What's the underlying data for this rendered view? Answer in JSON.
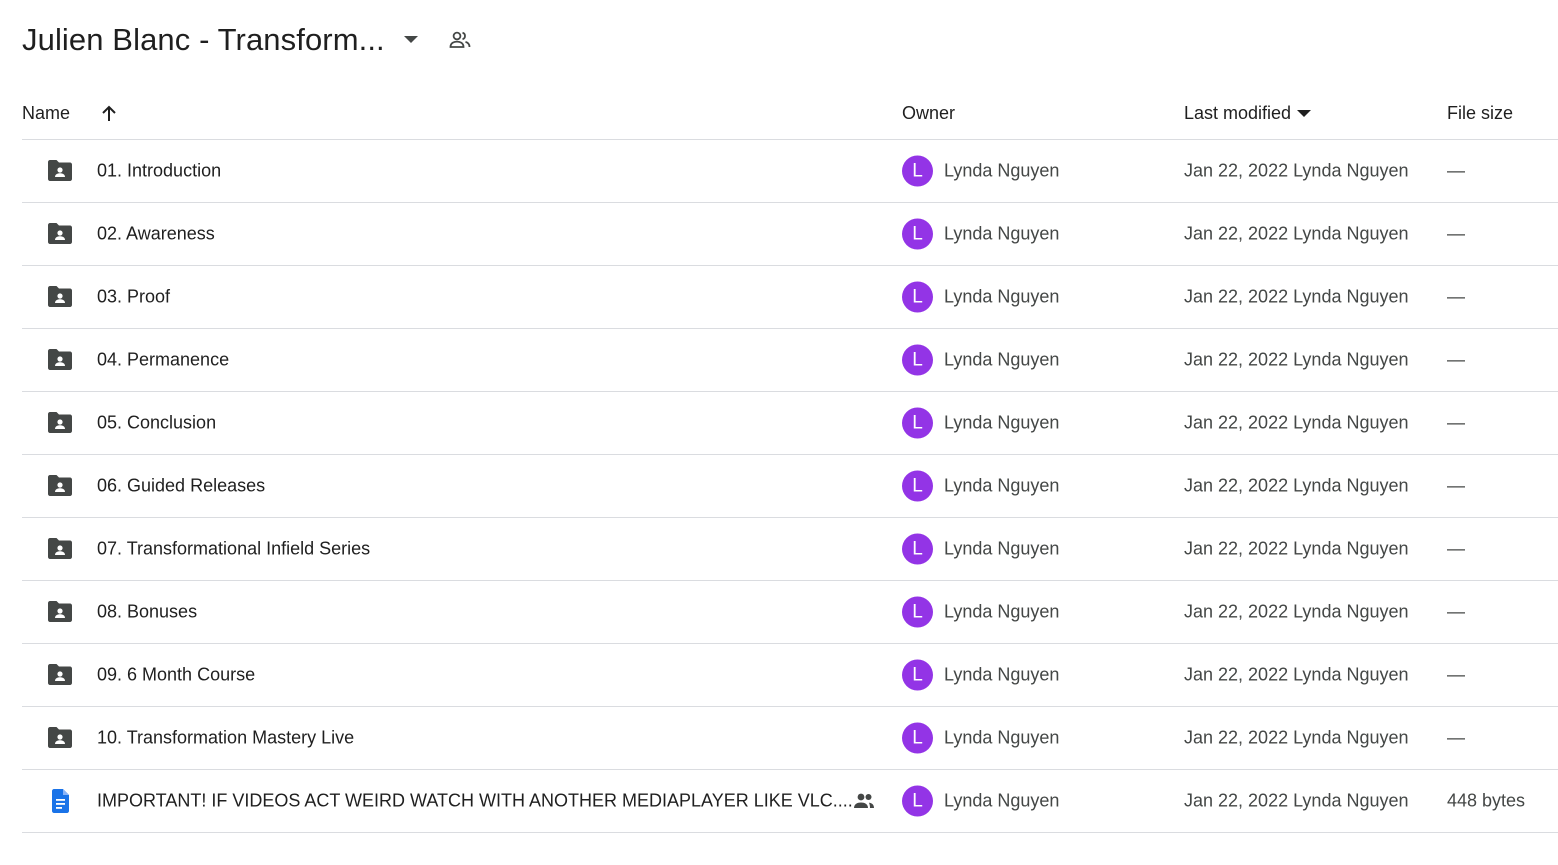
{
  "folder": {
    "title": "Julien Blanc - Transform..."
  },
  "columns": {
    "name": "Name",
    "owner": "Owner",
    "last_modified": "Last modified",
    "file_size": "File size"
  },
  "colors": {
    "avatar": "#9334e6",
    "folder_icon": "#444746",
    "doc_icon": "#1a73e8",
    "divider": "#dadce0"
  },
  "rows": [
    {
      "name": "01. Introduction",
      "type": "shared-folder",
      "owner_initial": "L",
      "owner": "Lynda Nguyen",
      "modified": "Jan 22, 2022 Lynda Nguyen",
      "size": "—"
    },
    {
      "name": "02. Awareness",
      "type": "shared-folder",
      "owner_initial": "L",
      "owner": "Lynda Nguyen",
      "modified": "Jan 22, 2022 Lynda Nguyen",
      "size": "—"
    },
    {
      "name": "03. Proof",
      "type": "shared-folder",
      "owner_initial": "L",
      "owner": "Lynda Nguyen",
      "modified": "Jan 22, 2022 Lynda Nguyen",
      "size": "—"
    },
    {
      "name": "04. Permanence",
      "type": "shared-folder",
      "owner_initial": "L",
      "owner": "Lynda Nguyen",
      "modified": "Jan 22, 2022 Lynda Nguyen",
      "size": "—"
    },
    {
      "name": "05. Conclusion",
      "type": "shared-folder",
      "owner_initial": "L",
      "owner": "Lynda Nguyen",
      "modified": "Jan 22, 2022 Lynda Nguyen",
      "size": "—"
    },
    {
      "name": "06. Guided Releases",
      "type": "shared-folder",
      "owner_initial": "L",
      "owner": "Lynda Nguyen",
      "modified": "Jan 22, 2022 Lynda Nguyen",
      "size": "—"
    },
    {
      "name": "07. Transformational Infield Series",
      "type": "shared-folder",
      "owner_initial": "L",
      "owner": "Lynda Nguyen",
      "modified": "Jan 22, 2022 Lynda Nguyen",
      "size": "—"
    },
    {
      "name": "08. Bonuses",
      "type": "shared-folder",
      "owner_initial": "L",
      "owner": "Lynda Nguyen",
      "modified": "Jan 22, 2022 Lynda Nguyen",
      "size": "—"
    },
    {
      "name": "09. 6 Month Course",
      "type": "shared-folder",
      "owner_initial": "L",
      "owner": "Lynda Nguyen",
      "modified": "Jan 22, 2022 Lynda Nguyen",
      "size": "—"
    },
    {
      "name": "10. Transformation Mastery Live",
      "type": "shared-folder",
      "owner_initial": "L",
      "owner": "Lynda Nguyen",
      "modified": "Jan 22, 2022 Lynda Nguyen",
      "size": "—"
    },
    {
      "name": "IMPORTANT! IF VIDEOS ACT WEIRD WATCH WITH ANOTHER MEDIAPLAYER LIKE VLC....",
      "type": "document",
      "shared": true,
      "owner_initial": "L",
      "owner": "Lynda Nguyen",
      "modified": "Jan 22, 2022 Lynda Nguyen",
      "size": "448 bytes"
    }
  ]
}
